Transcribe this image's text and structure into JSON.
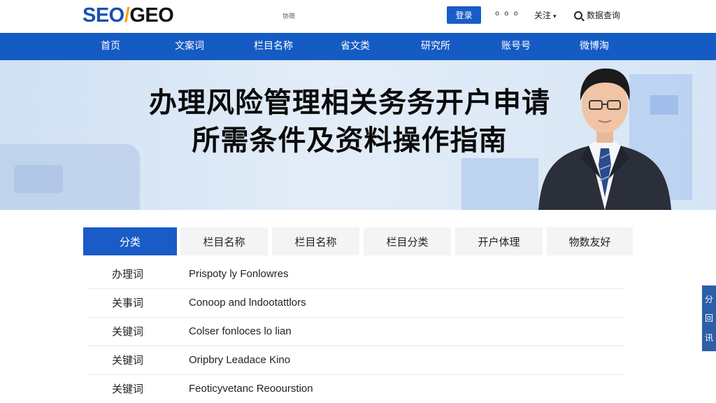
{
  "header": {
    "logo": {
      "seo": "SEO",
      "slash": "/",
      "geo": "GEO"
    },
    "small_text": "协简",
    "login_label": "登录",
    "dots": "o o o",
    "lang_label": "关注",
    "lang_chevron": "▾",
    "search_label": "数据查询"
  },
  "nav": {
    "items": [
      {
        "label": "首页"
      },
      {
        "label": "文案词"
      },
      {
        "label": "栏目名称"
      },
      {
        "label": "省文类"
      },
      {
        "label": "研究所"
      },
      {
        "label": "账号号"
      },
      {
        "label": "微博淘"
      }
    ]
  },
  "banner": {
    "title_line1": "办理风险管理相关务务开户申请",
    "title_line2": "所需条件及资料操作指南"
  },
  "tabs": [
    {
      "label": "分类",
      "active": true
    },
    {
      "label": "栏目名称",
      "active": false
    },
    {
      "label": "栏目名称",
      "active": false
    },
    {
      "label": "栏目分类",
      "active": false
    },
    {
      "label": "开户体理",
      "active": false
    },
    {
      "label": "物数友好",
      "active": false
    }
  ],
  "table": {
    "rows": [
      {
        "key": "办理词",
        "value": "Prispoty ly Fonlowres"
      },
      {
        "key": "关事词",
        "value": "Conoop and lndootattlors"
      },
      {
        "key": "关键词",
        "value": "Colser fonloces lo lian"
      },
      {
        "key": "关键词",
        "value": "Oripbry Leadace Kino"
      },
      {
        "key": "关键词",
        "value": "Feoticyvetanc Reoourstion"
      }
    ]
  },
  "side_float": {
    "items": [
      "分",
      "回",
      "讯"
    ]
  },
  "colors": {
    "brand_blue": "#155bc4",
    "logo_blue": "#1a4fb0",
    "logo_accent": "#f2a51a",
    "tab_active": "#1a5cc7"
  }
}
